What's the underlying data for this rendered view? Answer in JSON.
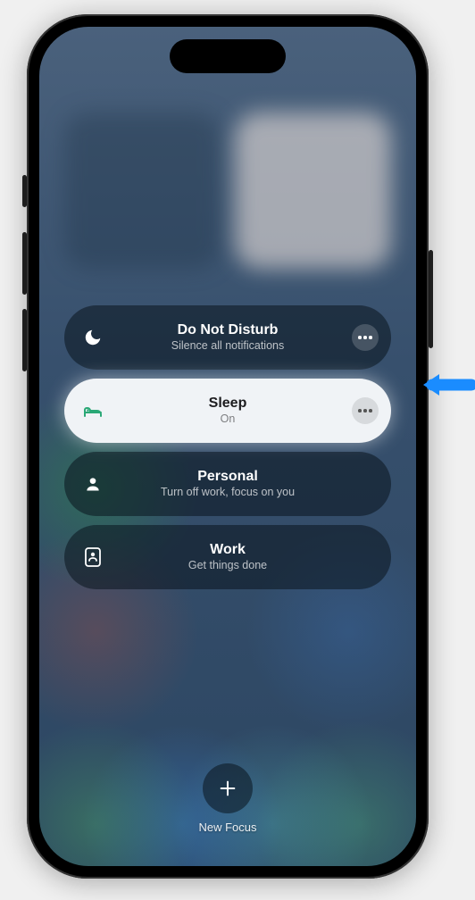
{
  "focus_items": [
    {
      "title": "Do Not Disturb",
      "subtitle": "Silence all notifications",
      "active": false,
      "icon": "moon"
    },
    {
      "title": "Sleep",
      "subtitle": "On",
      "active": true,
      "icon": "bed"
    },
    {
      "title": "Personal",
      "subtitle": "Turn off work, focus on you",
      "active": false,
      "icon": "person"
    },
    {
      "title": "Work",
      "subtitle": "Get things done",
      "active": false,
      "icon": "badge"
    }
  ],
  "new_focus": {
    "label": "New Focus"
  },
  "callout": {
    "color": "#1a8cff"
  }
}
